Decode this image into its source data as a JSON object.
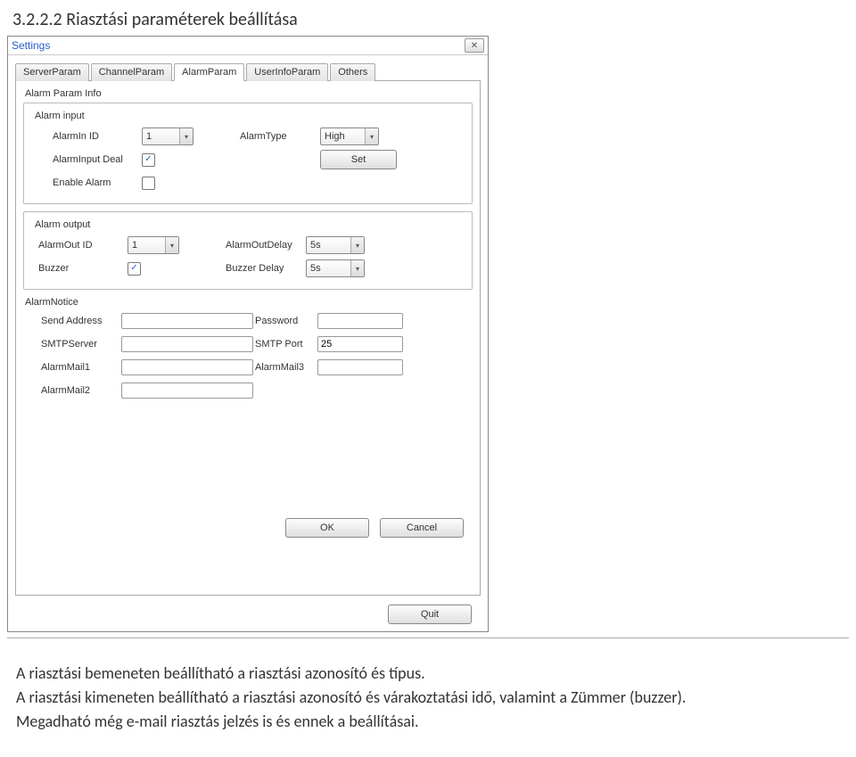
{
  "heading": "3.2.2.2 Riasztási paraméterek beállítása",
  "dialog": {
    "title": "Settings",
    "close_glyph": "✕",
    "tabs": [
      "ServerParam",
      "ChannelParam",
      "AlarmParam",
      "UserInfoParam",
      "Others"
    ],
    "active_tab": 2,
    "alarm_param_info": {
      "title": "Alarm Param Info",
      "alarm_input": {
        "title": "Alarm input",
        "alarmin_id_label": "AlarmIn ID",
        "alarmin_id_value": "1",
        "alarmtype_label": "AlarmType",
        "alarmtype_value": "High",
        "alarminput_deal_label": "AlarmInput Deal",
        "alarminput_deal_checked": true,
        "set_button_label": "Set",
        "enable_alarm_label": "Enable Alarm",
        "enable_alarm_checked": false
      },
      "alarm_output": {
        "title": "Alarm output",
        "alarmout_id_label": "AlarmOut ID",
        "alarmout_id_value": "1",
        "alarmout_delay_label": "AlarmOutDelay",
        "alarmout_delay_value": "5s",
        "buzzer_label": "Buzzer",
        "buzzer_checked": true,
        "buzzer_delay_label": "Buzzer Delay",
        "buzzer_delay_value": "5s"
      },
      "alarm_notice": {
        "title": "AlarmNotice",
        "send_address_label": "Send Address",
        "send_address_value": "",
        "password_label": "Password",
        "password_value": "",
        "smtp_server_label": "SMTPServer",
        "smtp_server_value": "",
        "smtp_port_label": "SMTP Port",
        "smtp_port_value": "25",
        "alarm_mail1_label": "AlarmMail1",
        "alarm_mail1_value": "",
        "alarm_mail3_label": "AlarmMail3",
        "alarm_mail3_value": "",
        "alarm_mail2_label": "AlarmMail2",
        "alarm_mail2_value": ""
      }
    },
    "buttons": {
      "ok": "OK",
      "cancel": "Cancel",
      "quit": "Quit"
    }
  },
  "paragraphs": {
    "p1": "A riasztási bemeneten beállítható a riasztási azonosító és típus.",
    "p2": "A riasztási kimeneten beállítható a riasztási azonosító és várakoztatási idő, valamint a Zümmer (buzzer).",
    "p3": "Megadható még e-mail riasztás jelzés is és ennek a beállításai."
  }
}
